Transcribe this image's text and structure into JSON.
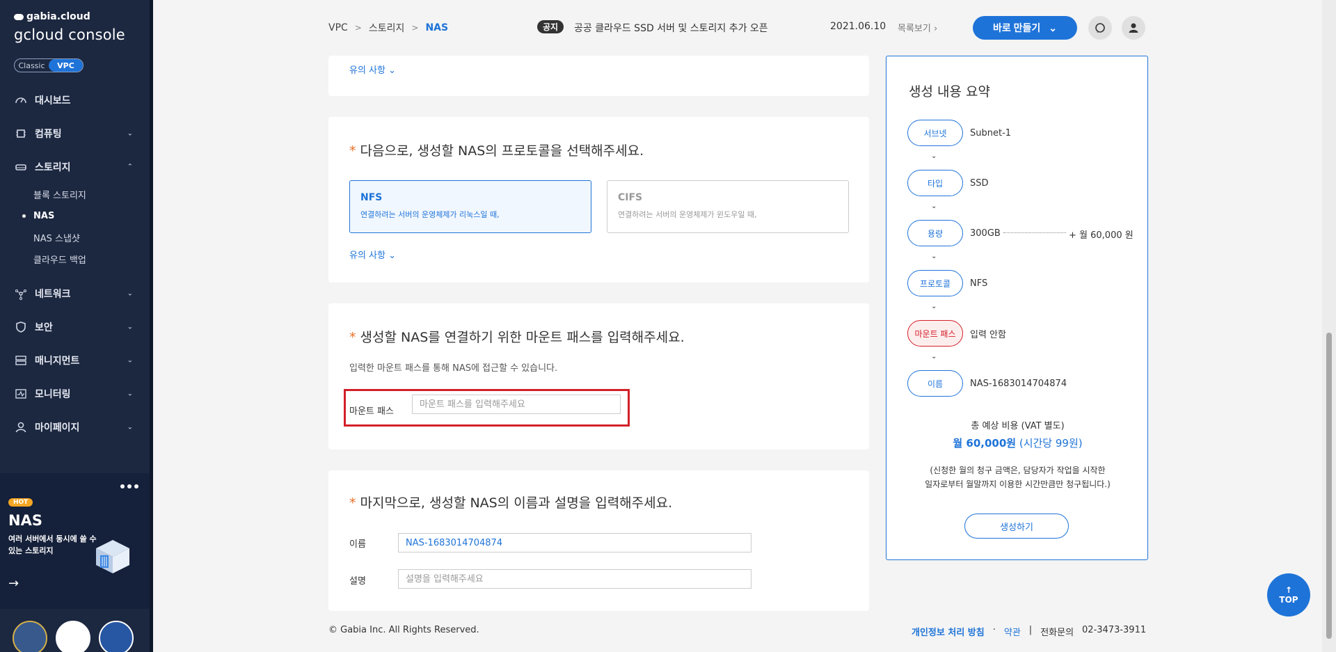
{
  "sidebar": {
    "brand_top": "gabia.cloud",
    "brand_main": "gcloud console",
    "toggle": {
      "classic": "Classic",
      "vpc": "VPC"
    },
    "items": [
      {
        "label": "대시보드",
        "icon": "dashboard-icon"
      },
      {
        "label": "컴퓨팅",
        "icon": "cpu-icon"
      },
      {
        "label": "스토리지",
        "icon": "storage-icon"
      },
      {
        "label": "네트워크",
        "icon": "network-icon"
      },
      {
        "label": "보안",
        "icon": "shield-icon"
      },
      {
        "label": "매니지먼트",
        "icon": "management-icon"
      },
      {
        "label": "모니터링",
        "icon": "monitoring-icon"
      },
      {
        "label": "마이페이지",
        "icon": "user-icon"
      }
    ],
    "storage_sub": [
      "블록 스토리지",
      "NAS",
      "NAS 스냅샷",
      "클라우드 백업"
    ],
    "promo": {
      "tag": "HOT",
      "title": "NAS",
      "desc": "여러 서버에서 동시에 쓸 수 있는 스토리지"
    }
  },
  "header": {
    "breadcrumb": [
      "VPC",
      "스토리지",
      "NAS"
    ],
    "notice_tag": "공지",
    "notice_text": "공공 클라우드 SSD 서버 및 스토리지 추가 오픈",
    "notice_date": "2021.06.10",
    "notice_more": "목록보기",
    "quick_button": "바로 만들기"
  },
  "sections": {
    "caution": "유의 사항",
    "protocol_title": "다음으로, 생성할 NAS의 프로토콜을 선택해주세요.",
    "protocols": [
      {
        "name": "NFS",
        "desc": "연결하려는 서버의 운영체제가 리눅스일 때,"
      },
      {
        "name": "CIFS",
        "desc": "연결하려는 서버의 운영체제가 윈도우일 때,"
      }
    ],
    "mount_title": "생성할 NAS를 연결하기 위한 마운트 패스를 입력해주세요.",
    "mount_desc": "입력한 마운트 패스를 통해 NAS에 접근할 수 있습니다.",
    "mount_label": "마운트 패스",
    "mount_placeholder": "마운트 패스를 입력해주세요",
    "name_title": "마지막으로, 생성할 NAS의 이름과 설명을 입력해주세요.",
    "name_label": "이름",
    "name_value": "NAS-1683014704874",
    "desc_label": "설명",
    "desc_placeholder": "설명을 입력해주세요"
  },
  "summary": {
    "title": "생성 내용 요약",
    "steps": [
      {
        "label": "서브넷",
        "value": "Subnet-1"
      },
      {
        "label": "타입",
        "value": "SSD"
      },
      {
        "label": "용량",
        "value": "300GB"
      },
      {
        "label": "프로토콜",
        "value": "NFS"
      },
      {
        "label": "마운트 패스",
        "value": "입력 안함"
      },
      {
        "label": "이름",
        "value": "NAS-1683014704874"
      }
    ],
    "capacity_price": "+ 월 60,000 원",
    "total_label": "총 예상 비용 (VAT 별도)",
    "total_price": "월 60,000원",
    "total_hourly": "(시간당 99원)",
    "note_line1": "(신청한 월의 청구 금액은, 담당자가 작업을 시작한",
    "note_line2": "일자로부터 월말까지 이용한 시간만큼만 청구됩니다.)",
    "create_button": "생성하기"
  },
  "footer": {
    "copyright": "© Gabia Inc. All Rights Reserved.",
    "privacy": "개인정보 처리 방침",
    "terms": "약관",
    "contact_label": "전화문의",
    "contact_number": "02-3473-3911",
    "top_label": "TOP"
  },
  "colors": {
    "accent": "#1e73d8",
    "warn": "#d3202a",
    "sidebar_bg": "#1c2740"
  }
}
